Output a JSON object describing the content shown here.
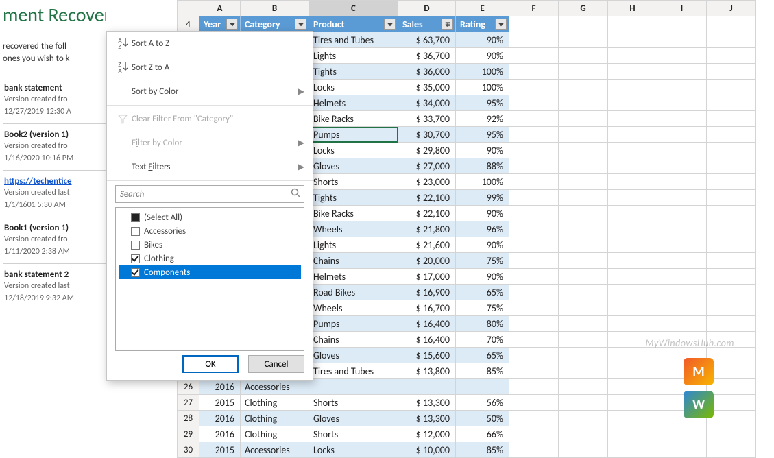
{
  "recovery": {
    "title": "ment Recovery",
    "desc_l1": "recovered the foll",
    "desc_l2": "ones you wish to k",
    "items": [
      {
        "title": "bank statement",
        "sub1": "Version created fro",
        "sub2": "12/27/2019 12:30 A"
      },
      {
        "title": "Book2 (version 1)",
        "sub1": "Version created fro",
        "sub2": "1/16/2020 10:16 PM"
      },
      {
        "title": "https://techentice",
        "is_url": true,
        "sub1": "Version created last",
        "sub2": "1/1/1601 5:30 AM"
      },
      {
        "title": "Book1 (version 1)",
        "sub1": "Version created fro",
        "sub2": "1/11/2020 2:38 AM"
      },
      {
        "title": "bank statement 2",
        "sub1": "Version created last",
        "sub2": "12/18/2019 9:32 AM"
      }
    ]
  },
  "columns": [
    "",
    "A",
    "B",
    "C",
    "D",
    "E",
    "F",
    "G",
    "H",
    "I",
    "J"
  ],
  "header_row_number": "4",
  "table_headers": {
    "year": "Year",
    "category": "Category",
    "product": "Product",
    "sales": "Sales",
    "rating": "Rating"
  },
  "filter_popup": {
    "sort_az": "Sort A to Z",
    "sort_za": "Sort Z to A",
    "sort_by_color": "Sort by Color",
    "clear_filter": "Clear Filter From \"Category\"",
    "filter_by_color": "Filter by Color",
    "text_filters": "Text Filters",
    "search_placeholder": "Search",
    "select_all": "(Select All)",
    "options": [
      {
        "label": "Accessories",
        "checked": false
      },
      {
        "label": "Bikes",
        "checked": false
      },
      {
        "label": "Clothing",
        "checked": true
      },
      {
        "label": "Components",
        "checked": true,
        "selected": true
      }
    ],
    "ok": "OK",
    "cancel": "Cancel"
  },
  "data_rows": [
    {
      "product": "Tires and Tubes",
      "sales": "$ 63,700",
      "rating": "90%",
      "band": true
    },
    {
      "product": "Lights",
      "sales": "$ 36,700",
      "rating": "90%",
      "band": false
    },
    {
      "product": "Tights",
      "sales": "$ 36,000",
      "rating": "100%",
      "band": true
    },
    {
      "product": "Locks",
      "sales": "$ 35,000",
      "rating": "100%",
      "band": false
    },
    {
      "product": "Helmets",
      "sales": "$ 34,000",
      "rating": "95%",
      "band": true
    },
    {
      "product": "Bike Racks",
      "sales": "$ 33,700",
      "rating": "92%",
      "band": false
    },
    {
      "product": "Pumps",
      "sales": "$ 30,700",
      "rating": "95%",
      "band": true,
      "selected": true
    },
    {
      "product": "Locks",
      "sales": "$ 29,800",
      "rating": "90%",
      "band": false
    },
    {
      "product": "Gloves",
      "sales": "$ 27,000",
      "rating": "88%",
      "band": true
    },
    {
      "product": "Shorts",
      "sales": "$ 23,000",
      "rating": "100%",
      "band": false
    },
    {
      "product": "Tights",
      "sales": "$ 22,100",
      "rating": "99%",
      "band": true
    },
    {
      "product": "Bike Racks",
      "sales": "$ 22,100",
      "rating": "90%",
      "band": false
    },
    {
      "product": "Wheels",
      "sales": "$ 21,800",
      "rating": "96%",
      "band": true
    },
    {
      "product": "Lights",
      "sales": "$ 21,600",
      "rating": "90%",
      "band": false
    },
    {
      "product": "Chains",
      "sales": "$ 20,000",
      "rating": "75%",
      "band": true
    },
    {
      "product": "Helmets",
      "sales": "$ 17,000",
      "rating": "90%",
      "band": false
    },
    {
      "product": "Road Bikes",
      "sales": "$ 16,900",
      "rating": "65%",
      "band": true
    },
    {
      "product": "Wheels",
      "sales": "$ 16,700",
      "rating": "75%",
      "band": false
    },
    {
      "product": "Pumps",
      "sales": "$ 16,400",
      "rating": "80%",
      "band": true
    },
    {
      "product": "Chains",
      "sales": "$ 16,400",
      "rating": "70%",
      "band": false
    },
    {
      "product": "Gloves",
      "sales": "$ 15,600",
      "rating": "65%",
      "band": true
    },
    {
      "product": "Tires and Tubes",
      "sales": "$ 13,800",
      "rating": "85%",
      "band": false
    }
  ],
  "bottom_rows": [
    {
      "num": "26",
      "year": "2016",
      "category": "Accessories",
      "product": "",
      "sales": "",
      "rating": "",
      "band": true,
      "partial": true
    },
    {
      "num": "27",
      "year": "2015",
      "category": "Clothing",
      "product": "Shorts",
      "sales": "$ 13,300",
      "rating": "56%",
      "band": false
    },
    {
      "num": "28",
      "year": "2016",
      "category": "Clothing",
      "product": "Gloves",
      "sales": "$ 13,300",
      "rating": "50%",
      "band": true
    },
    {
      "num": "29",
      "year": "2016",
      "category": "Clothing",
      "product": "Shorts",
      "sales": "$ 12,000",
      "rating": "66%",
      "band": false
    },
    {
      "num": "30",
      "year": "2015",
      "category": "Accessories",
      "product": "Locks",
      "sales": "$ 10,000",
      "rating": "85%",
      "band": true
    }
  ],
  "watermark": "MyWindowsHub.com",
  "chart_data": {
    "type": "table",
    "title": "Excel Data with Category Filter",
    "columns": [
      "Year",
      "Category",
      "Product",
      "Sales",
      "Rating"
    ],
    "rows": [
      [
        "",
        "",
        "Tires and Tubes",
        63700,
        0.9
      ],
      [
        "",
        "",
        "Lights",
        36700,
        0.9
      ],
      [
        "",
        "",
        "Tights",
        36000,
        1.0
      ],
      [
        "",
        "",
        "Locks",
        35000,
        1.0
      ],
      [
        "",
        "",
        "Helmets",
        34000,
        0.95
      ],
      [
        "",
        "",
        "Bike Racks",
        33700,
        0.92
      ],
      [
        "",
        "",
        "Pumps",
        30700,
        0.95
      ],
      [
        "",
        "",
        "Locks",
        29800,
        0.9
      ],
      [
        "",
        "",
        "Gloves",
        27000,
        0.88
      ],
      [
        "",
        "",
        "Shorts",
        23000,
        1.0
      ],
      [
        "",
        "",
        "Tights",
        22100,
        0.99
      ],
      [
        "",
        "",
        "Bike Racks",
        22100,
        0.9
      ],
      [
        "",
        "",
        "Wheels",
        21800,
        0.96
      ],
      [
        "",
        "",
        "Lights",
        21600,
        0.9
      ],
      [
        "",
        "",
        "Chains",
        20000,
        0.75
      ],
      [
        "",
        "",
        "Helmets",
        17000,
        0.9
      ],
      [
        "",
        "",
        "Road Bikes",
        16900,
        0.65
      ],
      [
        "",
        "",
        "Wheels",
        16700,
        0.75
      ],
      [
        "",
        "",
        "Pumps",
        16400,
        0.8
      ],
      [
        "",
        "",
        "Chains",
        16400,
        0.7
      ],
      [
        "",
        "",
        "Gloves",
        15600,
        0.65
      ],
      [
        "",
        "",
        "Tires and Tubes",
        13800,
        0.85
      ],
      [
        2016,
        "Accessories",
        "",
        null,
        null
      ],
      [
        2015,
        "Clothing",
        "Shorts",
        13300,
        0.56
      ],
      [
        2016,
        "Clothing",
        "Gloves",
        13300,
        0.5
      ],
      [
        2016,
        "Clothing",
        "Shorts",
        12000,
        0.66
      ],
      [
        2015,
        "Accessories",
        "Locks",
        10000,
        0.85
      ]
    ]
  }
}
